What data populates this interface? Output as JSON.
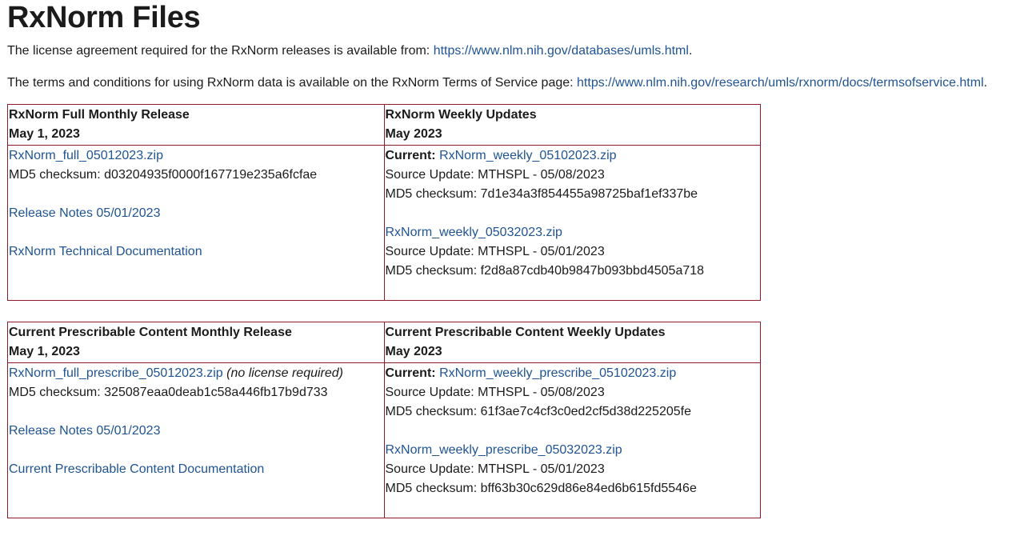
{
  "page": {
    "title": "RxNorm Files",
    "license_text": "The license agreement required for the RxNorm releases is available from: ",
    "license_link": "https://www.nlm.nih.gov/databases/umls.html",
    "license_end": ".",
    "terms_text": "The terms and conditions for using RxNorm data is available on the RxNorm Terms of Service page: ",
    "terms_link": "https://www.nlm.nih.gov/research/umls/rxnorm/docs/termsofservice.html",
    "terms_end": "."
  },
  "table1": {
    "left_header_title": "RxNorm Full Monthly Release",
    "left_header_date": "May 1, 2023",
    "right_header_title": "RxNorm Weekly Updates",
    "right_header_date": "May 2023",
    "full_file": "RxNorm_full_05012023.zip",
    "full_checksum": "MD5 checksum: d03204935f0000f167719e235a6fcfae",
    "release_notes": "Release Notes 05/01/2023",
    "tech_doc": "RxNorm Technical Documentation",
    "current_label": "Current:",
    "weekly1_file": "RxNorm_weekly_05102023.zip",
    "weekly1_source": "Source Update: MTHSPL - 05/08/2023",
    "weekly1_checksum": "MD5 checksum: 7d1e34a3f854455a98725baf1ef337be",
    "weekly2_file": "RxNorm_weekly_05032023.zip",
    "weekly2_source": "Source Update: MTHSPL - 05/01/2023",
    "weekly2_checksum": "MD5 checksum: f2d8a87cdb40b9847b093bbd4505a718"
  },
  "table2": {
    "left_header_title": "Current Prescribable Content Monthly Release",
    "left_header_date": "May 1, 2023",
    "right_header_title": "Current Prescribable Content Weekly Updates",
    "right_header_date": "May 2023",
    "full_file": "RxNorm_full_prescribe_05012023.zip",
    "no_license": "(no license required)",
    "full_checksum": "MD5 checksum: 325087eaa0deab1c58a446fb17b9d733",
    "release_notes": "Release Notes 05/01/2023",
    "cpc_doc": "Current Prescribable Content Documentation",
    "current_label": "Current:",
    "weekly1_file": "RxNorm_weekly_prescribe_05102023.zip",
    "weekly1_source": "Source Update: MTHSPL - 05/08/2023",
    "weekly1_checksum": "MD5 checksum: 61f3ae7c4cf3c0ed2cf5d38d225205fe",
    "weekly2_file": "RxNorm_weekly_prescribe_05032023.zip",
    "weekly2_source": "Source Update: MTHSPL - 05/01/2023",
    "weekly2_checksum": "MD5 checksum: bff63b30c629d86e84ed6b615fd5546e"
  },
  "colors": {
    "link": "#205493",
    "border": "#8b1a2b",
    "text": "#1b1b1b"
  }
}
